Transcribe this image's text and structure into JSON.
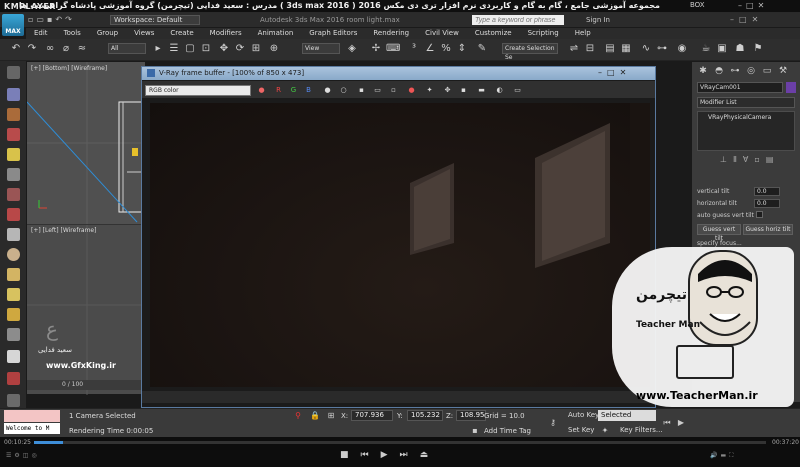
{
  "player": {
    "name": "KMPLAYER",
    "caption": "مجموعه آموزشی جامع ، گام به گام و کاربردی نرم افزار تری دی مکس 2016 ( 3ds max 2016 ) مدرس : سعید فدایی (تیچرمن) گروه آموزشی پادشاه گرافیست ها",
    "right_label": "BOX",
    "time_current": "00:10:25",
    "time_total": "00:37:20",
    "progress_fraction": 0.04
  },
  "max": {
    "logo": "MAX",
    "workspace": "Workspace: Default",
    "title": "Autodesk 3ds Max 2016    room light.max",
    "search_placeholder": "Type a keyword or phrase",
    "signin": "Sign In",
    "menus": [
      "Edit",
      "Tools",
      "Group",
      "Views",
      "Create",
      "Modifiers",
      "Animation",
      "Graph Editors",
      "Rendering",
      "Civil View",
      "Customize",
      "Scripting",
      "Help"
    ],
    "toolbar": {
      "filter": "All",
      "refcoord": "View",
      "selection_set": "Create Selection Se"
    }
  },
  "viewports": {
    "top_label": "[+] [Bottom] [Wireframe]",
    "left_label": "[+] [Left] [Wireframe]",
    "timeline": "0 / 100"
  },
  "vfb": {
    "title": "V-Ray frame buffer - [100% of 850 x 473]",
    "channel": "RGB color",
    "btn_r": "R",
    "btn_g": "G",
    "btn_b": "B"
  },
  "command_panel": {
    "object_name": "VRayCam001",
    "modifier_list": "Modifier List",
    "stack_item": "VRayPhysicalCamera",
    "params": {
      "vertical_tilt_label": "vertical tilt",
      "vertical_tilt": "0.0",
      "horizontal_tilt_label": "horizontal tilt",
      "horizontal_tilt": "0.0",
      "auto_guess_label": "auto guess vert tilt",
      "guess_vert": "Guess vert tilt",
      "guess_horiz": "Guess horiz tilt",
      "specify_focus": "specify focus..."
    }
  },
  "status": {
    "welcome": "Welcome to M",
    "selection": "1 Camera Selected",
    "rendering": "Rendering Time  0:00:05",
    "x_label": "X:",
    "x": "707.936",
    "y_label": "Y:",
    "y": "105.232",
    "z_label": "Z:",
    "z": "108.95",
    "grid": "Grid = 10.0",
    "add_time_tag": "Add Time Tag",
    "auto_key": "Auto Key",
    "set_key": "Set Key",
    "selected": "Selected",
    "key_filters": "Key Filters..."
  },
  "watermarks": {
    "left_name": "سعید فدایی",
    "left_site": "www.GfxKing.ir",
    "teacher_fa": "تیچرمن",
    "teacher_en": "Teacher Man",
    "teacher_site": "www.TeacherMan.ir"
  }
}
